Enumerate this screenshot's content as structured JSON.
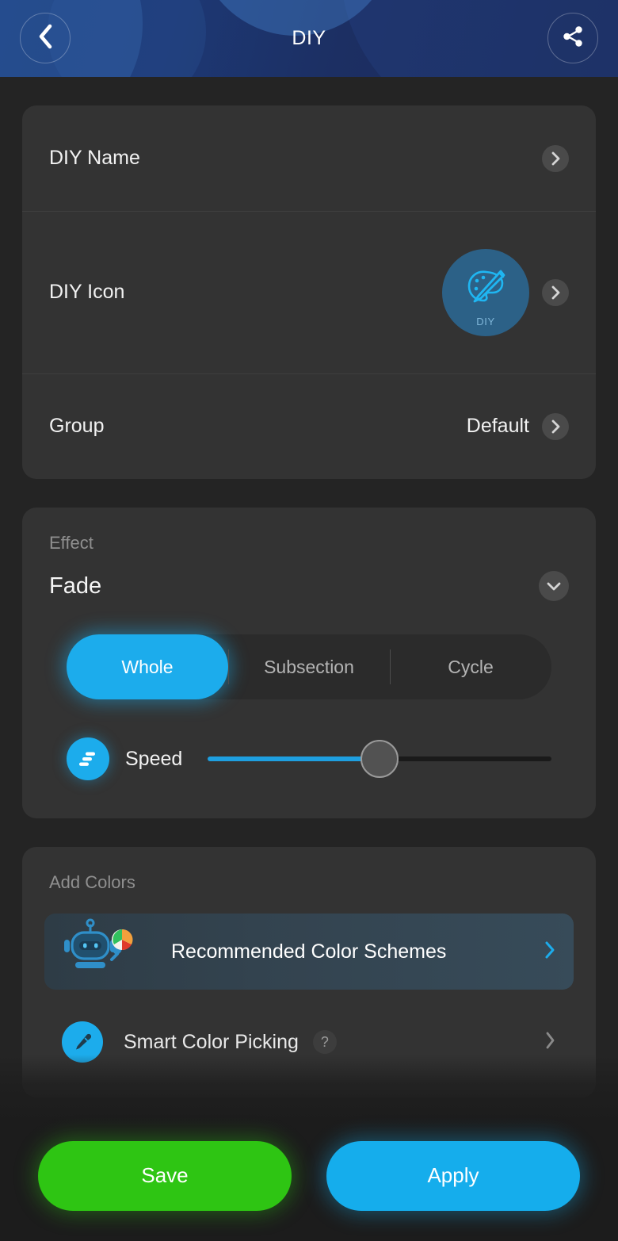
{
  "header": {
    "title": "DIY",
    "back_icon": "chevron-left-icon",
    "share_icon": "share-icon"
  },
  "info_card": {
    "rows": [
      {
        "label": "DIY Name",
        "value": "",
        "chevron": "chevron-right-icon"
      },
      {
        "label": "DIY Icon",
        "value": "",
        "icon_caption": "DIY",
        "chevron": "chevron-right-icon"
      },
      {
        "label": "Group",
        "value": "Default",
        "chevron": "chevron-right-icon"
      }
    ]
  },
  "effect_card": {
    "section_label": "Effect",
    "selected_effect": "Fade",
    "caret_icon": "chevron-down-icon",
    "modes": [
      {
        "label": "Whole",
        "active": true
      },
      {
        "label": "Subsection",
        "active": false
      },
      {
        "label": "Cycle",
        "active": false
      }
    ],
    "speed": {
      "label": "Speed",
      "icon": "speed-icon",
      "value_percent": 50
    }
  },
  "colors_card": {
    "section_label": "Add Colors",
    "recommended": {
      "label": "Recommended Color Schemes",
      "icon": "robot-palette-icon",
      "chevron": "chevron-right-icon"
    },
    "smart_picking": {
      "label": "Smart Color Picking",
      "icon": "eyedropper-icon",
      "help_badge": "?",
      "chevron": "chevron-right-icon"
    }
  },
  "footer": {
    "save_label": "Save",
    "apply_label": "Apply"
  },
  "colors": {
    "accent_cyan": "#1cacec",
    "save_green": "#2ec513",
    "header_blue": "#1b2a58",
    "card_bg": "#333333",
    "page_bg": "#242424"
  }
}
